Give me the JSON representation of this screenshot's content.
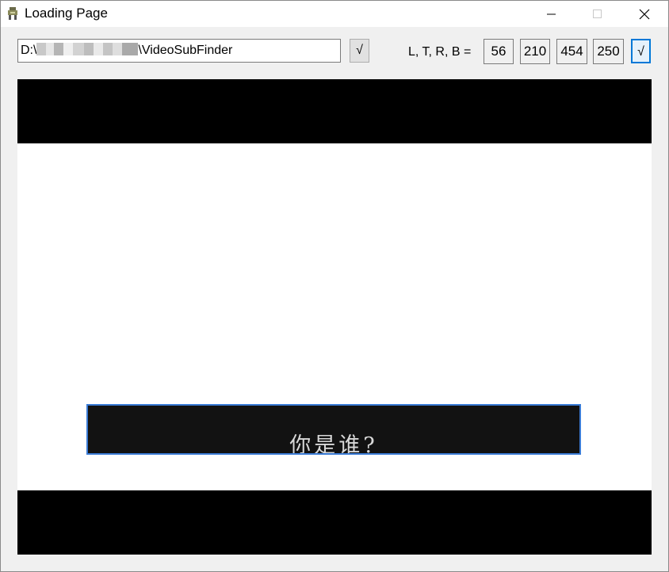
{
  "window": {
    "title": "Loading Page"
  },
  "toolbar": {
    "path_prefix": "D:\\",
    "path_suffix": "\\VideoSubFinder",
    "path_ok_label": "√",
    "ltrb_label": "L, T, R, B =",
    "left": "56",
    "top": "210",
    "right": "454",
    "bottom": "250",
    "ltrb_ok_label": "√"
  },
  "preview": {
    "subtitle": "你是谁?"
  },
  "colors": {
    "accent": "#0078d7",
    "selection": "#3a7bd5"
  }
}
